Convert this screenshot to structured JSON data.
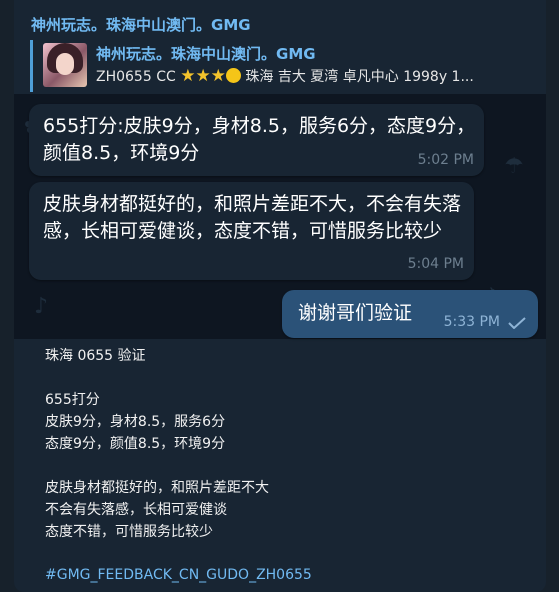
{
  "message": {
    "sender": "神州玩志。珠海中山澳门。GMG",
    "reply": {
      "title": "神州玩志。珠海中山澳门。GMG",
      "text_prefix": "ZH0655 CC ",
      "stars": "★★★",
      "text_suffix": " 珠海 吉大 夏湾 卓凡中心 1998y  1..."
    },
    "photo": {
      "bubbles": [
        {
          "text": "655打分:皮肤9分，身材8.5，服务6分，态度9分，颜值8.5，环境9分",
          "time": "5:02 PM"
        },
        {
          "text": "皮肤身材都挺好的，和照片差距不大，不会有失落感，长相可爱健谈，态度不错，可惜服务比较少",
          "time": "5:04 PM"
        },
        {
          "text": "谢谢哥们验证",
          "time": "5:33 PM"
        }
      ]
    },
    "caption": {
      "line1": "珠海 0655 验证",
      "line2": "655打分",
      "line3": "皮肤9分，身材8.5，服务6分",
      "line4": "态度9分，颜值8.5，环境9分",
      "line5": "皮肤身材都挺好的，和照片差距不大",
      "line6": "不会有失落感，长相可爱健谈",
      "line7": "态度不错，可惜服务比较少"
    },
    "hashtag": "#GMG_FEEDBACK_CN_GUDO_ZH0655"
  },
  "colors": {
    "background": "#17212b",
    "link": "#71baf2",
    "outgoing_bubble": "#2b5278",
    "incoming_bubble": "#182533"
  }
}
